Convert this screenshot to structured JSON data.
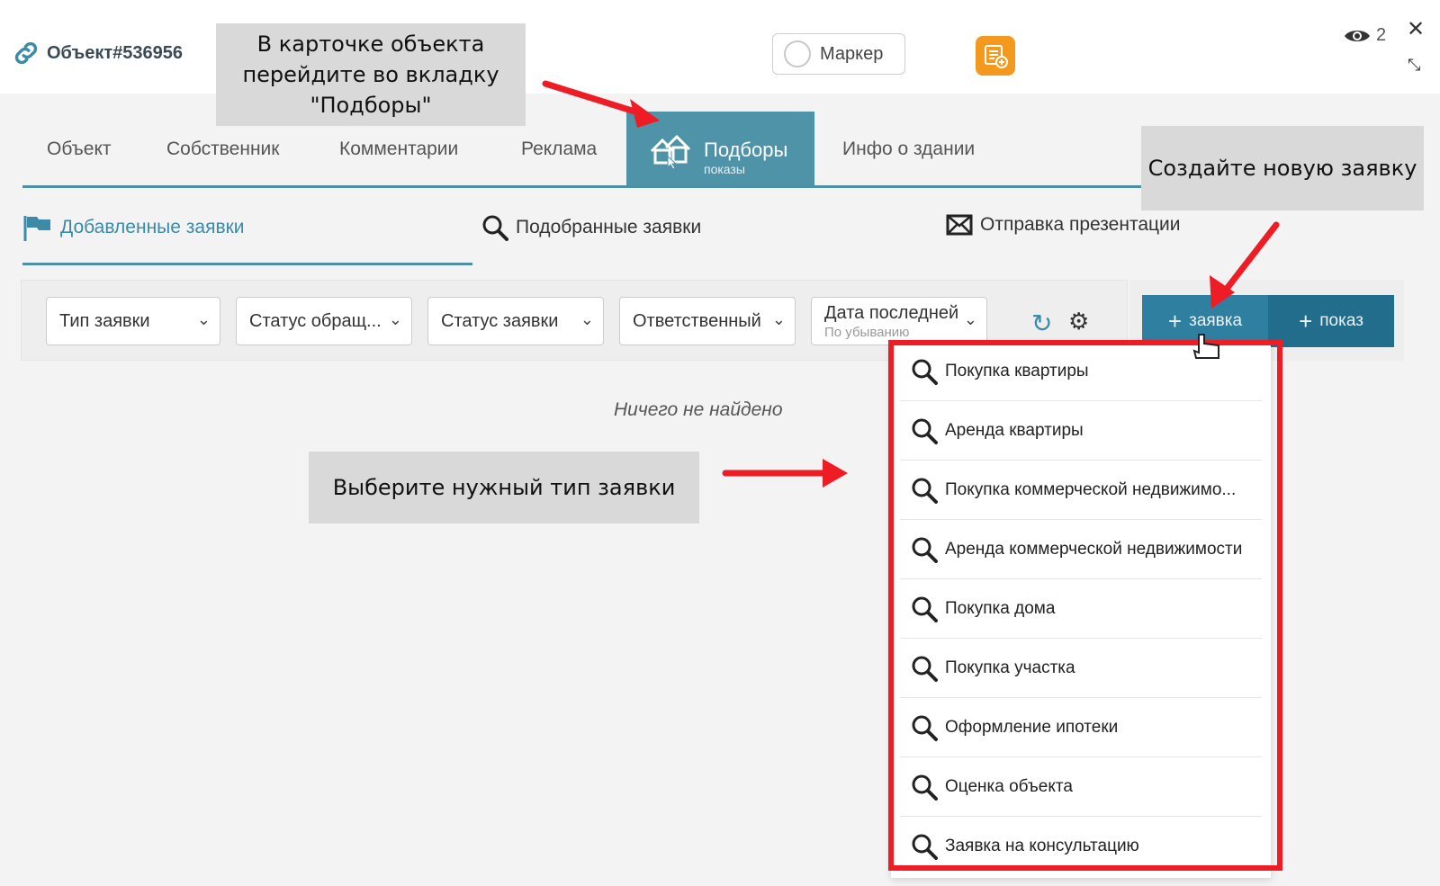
{
  "header": {
    "object_title": "Объект#536956",
    "marker_label": "Маркер",
    "viewers_count": "2",
    "close_glyph": "✕",
    "shrink_glyph": "⤡"
  },
  "callouts": {
    "go_to_tab": "В карточке объекта перейдите во вкладку \"Подборы\"",
    "create_request": "Создайте новую заявку",
    "choose_type": "Выберите нужный тип заявки"
  },
  "tabs": [
    {
      "label": "Объект"
    },
    {
      "label": "Собственник"
    },
    {
      "label": "Комментарии"
    },
    {
      "label": "Реклама"
    },
    {
      "label": "Подборы",
      "sub": "показы",
      "active": true
    },
    {
      "label": "Инфо о здании"
    }
  ],
  "subtabs": {
    "added": "Добавленные заявки",
    "matched": "Подобранные заявки",
    "presentation": "Отправка презентации"
  },
  "filters": {
    "type": "Тип заявки",
    "appeal_status": "Статус обращ...",
    "request_status": "Статус заявки",
    "responsible": "Ответственный",
    "date": "Дата последней",
    "date_sort": "По убыванию"
  },
  "actions": {
    "add_request": "заявка",
    "add_showing": "показ"
  },
  "empty_text": "Ничего не найдено",
  "dropdown_items": [
    "Покупка квартиры",
    "Аренда квартиры",
    "Покупка коммерческой недвижимо...",
    "Аренда коммерческой недвижимости",
    "Покупка дома",
    "Покупка участка",
    "Оформление ипотеки",
    "Оценка объекта",
    "Заявка на консультацию"
  ],
  "colors": {
    "accent": "#4e93a8",
    "primary_button": "#2f7fa1",
    "annotation_red": "#ee1c25",
    "orange_button": "#f39a1e"
  }
}
